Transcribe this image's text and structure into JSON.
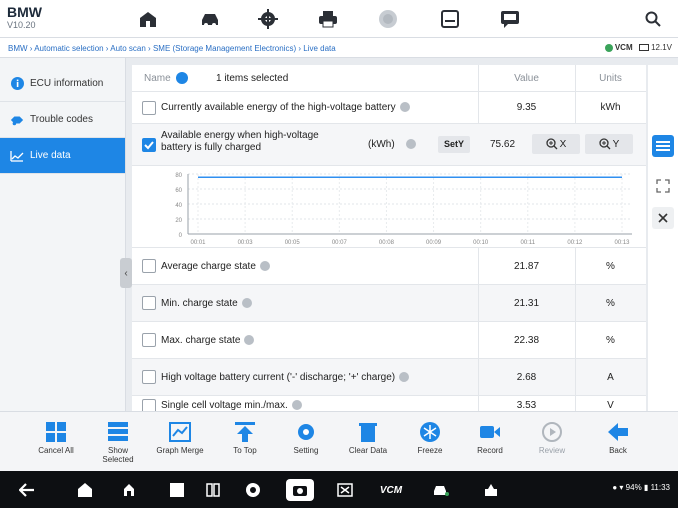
{
  "app": {
    "brand": "BMW",
    "version": "V10.20"
  },
  "top_toolbar": [
    {
      "name": "home-icon"
    },
    {
      "name": "vehicle-icon"
    },
    {
      "name": "settings-icon"
    },
    {
      "name": "print-icon"
    },
    {
      "name": "help-icon"
    },
    {
      "name": "save-icon"
    },
    {
      "name": "message-icon"
    },
    {
      "name": "search-icon"
    }
  ],
  "breadcrumb": {
    "path": "BMW › Automatic selection › Auto scan › SME (Storage Management Electronics) › Live data",
    "vci": "VCM",
    "voltage": "12.1V"
  },
  "sidebar": {
    "items": [
      {
        "label": "ECU information",
        "icon": "info-icon"
      },
      {
        "label": "Trouble codes",
        "icon": "trouble-codes-icon"
      },
      {
        "label": "Live data",
        "icon": "live-data-icon"
      }
    ]
  },
  "table": {
    "header": {
      "name": "Name",
      "selected": "1 items selected",
      "value": "Value",
      "units": "Units"
    },
    "row1": {
      "name": "Currently available energy of the high-voltage battery",
      "value": "9.35",
      "unit": "kWh"
    },
    "row2": {
      "name": "Available energy when high-voltage battery is fully charged",
      "unit": "(kWh)",
      "value": "75.62",
      "sety": "SetY",
      "x": "X",
      "y": "Y"
    },
    "rows": [
      {
        "name": "Average charge state",
        "value": "21.87",
        "unit": "%"
      },
      {
        "name": "Min. charge state",
        "value": "21.31",
        "unit": "%"
      },
      {
        "name": "Max. charge state",
        "value": "22.38",
        "unit": "%"
      },
      {
        "name": "High voltage battery current ('-' discharge; '+' charge)",
        "value": "2.68",
        "unit": "A"
      },
      {
        "name": "Single cell voltage min./max.",
        "value": "3.53",
        "unit": "V"
      }
    ]
  },
  "chart_data": {
    "type": "line",
    "x": [
      "00:01",
      "00:03",
      "00:05",
      "00:07",
      "00:08",
      "00:09",
      "00:10",
      "00:11",
      "00:12",
      "00:13"
    ],
    "y_ticks": [
      "80",
      "60",
      "40",
      "20",
      "0"
    ],
    "series": [
      {
        "values": [
          75.62,
          75.62,
          75.62,
          75.62,
          75.62,
          75.62,
          75.62,
          75.62,
          75.62,
          75.62
        ]
      }
    ],
    "ylim": [
      0,
      80
    ]
  },
  "bottom_toolbar": [
    {
      "label": "Cancel All",
      "icon": "cancel-all-icon"
    },
    {
      "label": "Show Selected",
      "icon": "show-selected-icon"
    },
    {
      "label": "Graph Merge",
      "icon": "graph-merge-icon"
    },
    {
      "label": "To Top",
      "icon": "to-top-icon"
    },
    {
      "label": "Setting",
      "icon": "setting-icon"
    },
    {
      "label": "Clear Data",
      "icon": "clear-data-icon"
    },
    {
      "label": "Freeze",
      "icon": "freeze-icon"
    },
    {
      "label": "Record",
      "icon": "record-icon"
    },
    {
      "label": "Review",
      "icon": "review-icon"
    },
    {
      "label": "Back",
      "icon": "back-icon"
    }
  ],
  "status": {
    "battery": "94%",
    "time": "11:33"
  },
  "colors": {
    "accent": "#1e86e5",
    "line": "#2f8ff0"
  }
}
